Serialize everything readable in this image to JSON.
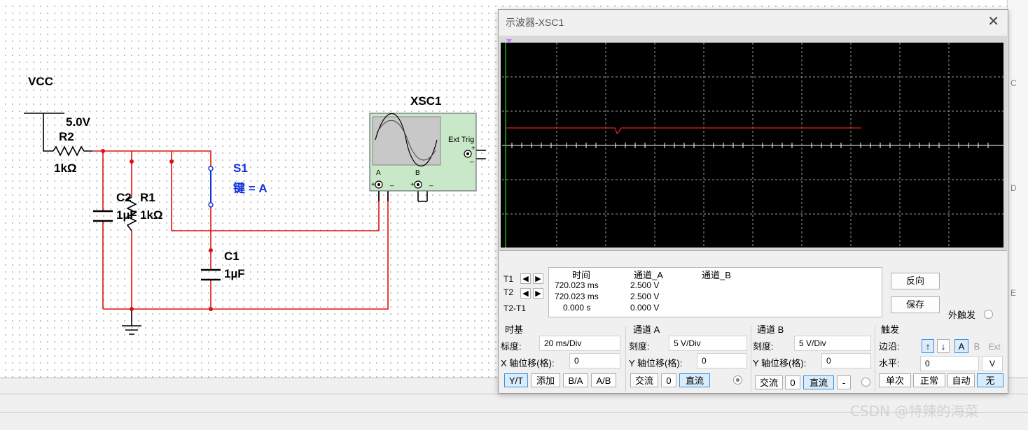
{
  "circuit": {
    "vcc_name": "VCC",
    "vcc_value": "5.0V",
    "r2_name": "R2",
    "r2_value": "1kΩ",
    "c2_name": "C2",
    "c2_value": "1µF",
    "r1_name": "R1",
    "r1_value": "1kΩ",
    "s1_name": "S1",
    "s1_key": "键 = A",
    "c1_name": "C1",
    "c1_value": "1µF",
    "xsc_name": "XSC1",
    "ext_trig": "Ext Trig",
    "ch_a": "A",
    "ch_b": "B",
    "plus": "+",
    "minus": "_"
  },
  "ruler": [
    "C",
    "D",
    "E"
  ],
  "scope": {
    "title": "示波器-XSC1",
    "close_icon": "close-icon",
    "trace_color": "#e02020",
    "readout": {
      "headers": [
        "时间",
        "通道_A",
        "通道_B"
      ],
      "rows": [
        {
          "label": "T1",
          "time": "720.023 ms",
          "a": "2.500 V",
          "b": ""
        },
        {
          "label": "T2",
          "time": "720.023 ms",
          "a": "2.500 V",
          "b": ""
        },
        {
          "label": "T2-T1",
          "time": "0.000 s",
          "a": "0.000 V",
          "b": ""
        }
      ]
    },
    "reverse_btn": "反向",
    "save_btn": "保存",
    "ext_trigger": "外触发",
    "timebase": {
      "title": "时基",
      "scale_label": "标度:",
      "scale_value": "20 ms/Div",
      "xpos_label": "X 轴位移(格):",
      "xpos_value": "0",
      "modes": [
        "Y/T",
        "添加",
        "B/A",
        "A/B"
      ]
    },
    "channel_a": {
      "title": "通道 A",
      "scale_label": "刻度:",
      "scale_value": "5  V/Div",
      "ypos_label": "Y 轴位移(格):",
      "ypos_value": "0",
      "ac": "交流",
      "zero": "0",
      "dc": "直流"
    },
    "channel_b": {
      "title": "通道 B",
      "scale_label": "刻度:",
      "scale_value": "5  V/Div",
      "ypos_label": "Y 轴位移(格):",
      "ypos_value": "0",
      "ac": "交流",
      "zero": "0",
      "dc": "直流",
      "minus": "-"
    },
    "trigger": {
      "title": "触发",
      "edge_label": "边沿:",
      "src_a": "A",
      "src_b": "B",
      "src_ext": "Ext",
      "level_label": "水平:",
      "level_value": "0",
      "level_unit": "V",
      "single": "单次",
      "normal": "正常",
      "auto": "自动",
      "none": "无"
    }
  },
  "watermark": "CSDN @特辣的海菜"
}
